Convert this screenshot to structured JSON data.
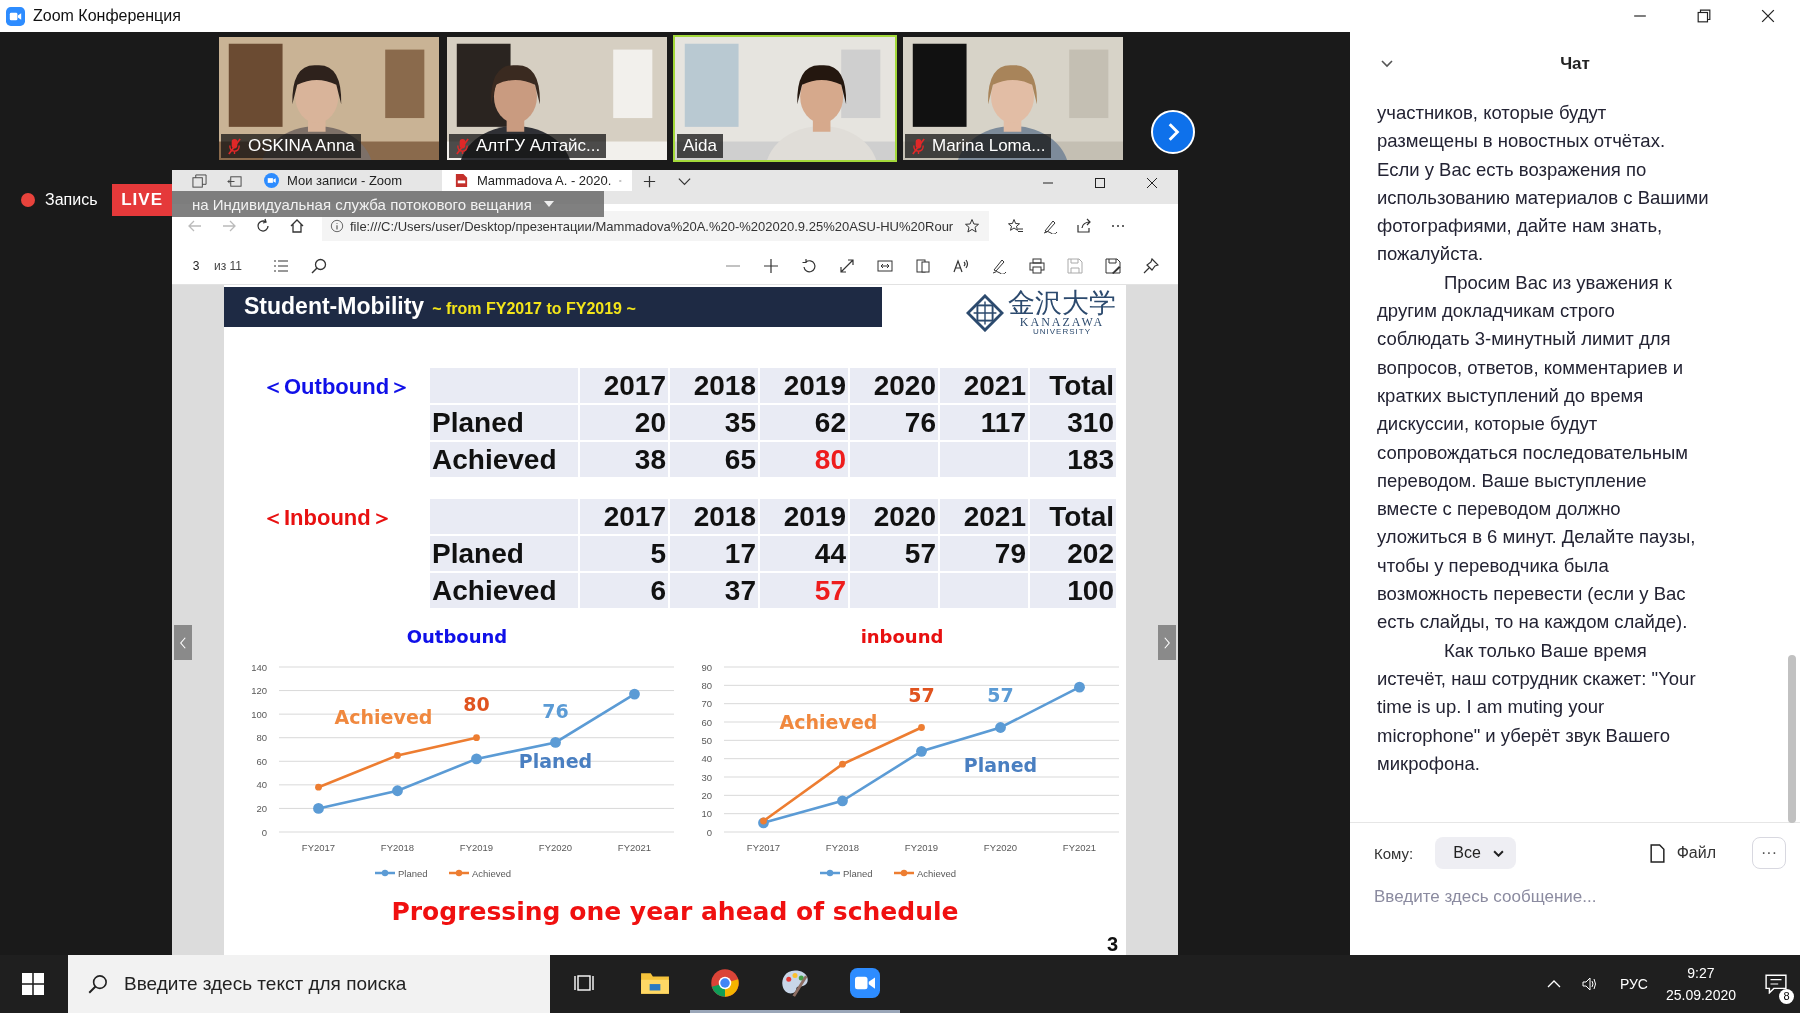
{
  "window": {
    "title": "Zoom Конференция"
  },
  "participants": [
    {
      "name": "OSKINA Anna",
      "muted": true,
      "speaking": false
    },
    {
      "name": "АлтГУ Алтайс...",
      "muted": true,
      "speaking": false
    },
    {
      "name": "Aida",
      "muted": false,
      "speaking": true
    },
    {
      "name": "Marina Loma...",
      "muted": true,
      "speaking": false
    }
  ],
  "recording": {
    "label": "Запись",
    "live": "LIVE",
    "stream_banner": "на Индивидуальная служба потокового вещания"
  },
  "browser": {
    "tabs": [
      {
        "label": "Мои записи - Zoom",
        "kind": "zoom",
        "selected": false
      },
      {
        "label": "Mammadova A. - 2020.",
        "kind": "pdf",
        "selected": true
      }
    ],
    "address": "file:///C:/Users/user/Desktop/презентации/Mammadova%20A.%20-%202020.9.25%20ASU-HU%20Rour",
    "page": "3",
    "page_count": "из 11"
  },
  "slide": {
    "title": "Student-Mobility",
    "subtitle": "~ from FY2017 to FY2019 ~",
    "logo": {
      "kanji": "金沢大学",
      "name": "KANAZAWA",
      "sub": "UNIVERSITY"
    },
    "tables": [
      {
        "label": "＜Outbound＞",
        "color": "#1010e8",
        "columns": [
          "2017",
          "2018",
          "2019",
          "2020",
          "2021",
          "Total"
        ],
        "rows": [
          {
            "label": "Planed",
            "cells": [
              {
                "text": "20",
                "highlight": false
              },
              {
                "text": "35",
                "highlight": false
              },
              {
                "text": "62",
                "highlight": false
              },
              {
                "text": "76",
                "highlight": false
              },
              {
                "text": "117",
                "highlight": false
              },
              {
                "text": "310",
                "highlight": false
              }
            ]
          },
          {
            "label": "Achieved",
            "cells": [
              {
                "text": "38",
                "highlight": false
              },
              {
                "text": "65",
                "highlight": false
              },
              {
                "text": "80",
                "highlight": true
              },
              null,
              null,
              {
                "text": "183",
                "highlight": false
              }
            ]
          }
        ]
      },
      {
        "label": "＜Inbound＞",
        "color": "#e81010",
        "columns": [
          "2017",
          "2018",
          "2019",
          "2020",
          "2021",
          "Total"
        ],
        "rows": [
          {
            "label": "Planed",
            "cells": [
              {
                "text": "5",
                "highlight": false
              },
              {
                "text": "17",
                "highlight": false
              },
              {
                "text": "44",
                "highlight": false
              },
              {
                "text": "57",
                "highlight": false
              },
              {
                "text": "79",
                "highlight": false
              },
              {
                "text": "202",
                "highlight": false
              }
            ]
          },
          {
            "label": "Achieved",
            "cells": [
              {
                "text": "6",
                "highlight": false
              },
              {
                "text": "37",
                "highlight": false
              },
              {
                "text": "57",
                "highlight": true
              },
              null,
              null,
              {
                "text": "100",
                "highlight": false
              }
            ]
          }
        ]
      }
    ],
    "charts": [
      {
        "chart_data": {
          "type": "line",
          "title": "Outbound",
          "grid": true,
          "legend": "bottom",
          "categories": [
            "FY2017",
            "FY2018",
            "FY2019",
            "FY2020",
            "FY2021"
          ],
          "ylim": [
            0,
            140
          ],
          "yticks": [
            0,
            20,
            40,
            60,
            80,
            100,
            120,
            140
          ],
          "series": [
            {
              "name": "Planed",
              "color": "#5b9bd5",
              "marker": "circle",
              "values": [
                20,
                35,
                62,
                76,
                117
              ]
            },
            {
              "name": "Achieved",
              "color": "#ed7d31",
              "marker": "circle",
              "values": [
                38,
                65,
                80,
                null,
                null
              ]
            }
          ],
          "annotations": [
            "Achieved",
            "80",
            "76",
            "Planed"
          ]
        }
      },
      {
        "chart_data": {
          "type": "line",
          "title": "inbound",
          "grid": true,
          "legend": "bottom",
          "categories": [
            "FY2017",
            "FY2018",
            "FY2019",
            "FY2020",
            "FY2021"
          ],
          "ylim": [
            0,
            90
          ],
          "yticks": [
            0,
            10,
            20,
            30,
            40,
            50,
            60,
            70,
            80,
            90
          ],
          "series": [
            {
              "name": "Planed",
              "color": "#5b9bd5",
              "marker": "circle",
              "values": [
                5,
                17,
                44,
                57,
                79
              ]
            },
            {
              "name": "Achieved",
              "color": "#ed7d31",
              "marker": "circle",
              "values": [
                6,
                37,
                57,
                null,
                null
              ]
            }
          ],
          "annotations": [
            "Achieved",
            "57",
            "57",
            "Planed"
          ]
        }
      }
    ],
    "footer": "Progressing one year ahead of schedule",
    "page_number": "3"
  },
  "chat": {
    "title": "Чат",
    "messages": [
      {
        "text": "участников, которые будут размещены в новостных отчётах. Если у Вас есть возражения по использованию материалов с Вашими фотографиями, дайте нам знать, пожалуйста.",
        "indent": false
      },
      {
        "text": "Просим Вас из уважения к другим докладчикам строго соблюдать 3-минутный лимит для вопросов, ответов, комментариев и кратких выступлений до время дискуссии, которые будут сопровождаться последовательным переводом. Ваше выступление вместе с переводом должно уложиться в 6 минут. Делайте паузы, чтобы у переводчика была возможность перевести (если у Вас есть слайды, то на каждом слайде).",
        "indent": true
      },
      {
        "text": "Как только Ваше время истечёт, наш сотрудник скажет: \"Your time is up. I am muting your microphone\" и уберёт звук Вашего микрофона.",
        "indent": true
      }
    ],
    "to_label": "Кому:",
    "recipient": "Все",
    "file": "Файл",
    "more": "···",
    "placeholder": "Введите здесь сообщение..."
  },
  "taskbar": {
    "search_placeholder": "Введите здесь текст для поиска",
    "apps": [
      {
        "kind": "taskview",
        "running": false
      },
      {
        "kind": "explorer",
        "running": false
      },
      {
        "kind": "browser",
        "running": true
      },
      {
        "kind": "paint",
        "running": true
      },
      {
        "kind": "zoom",
        "running": true
      }
    ],
    "language": "РУС",
    "time": "9:27",
    "date": "25.09.2020",
    "notifications": "8"
  }
}
